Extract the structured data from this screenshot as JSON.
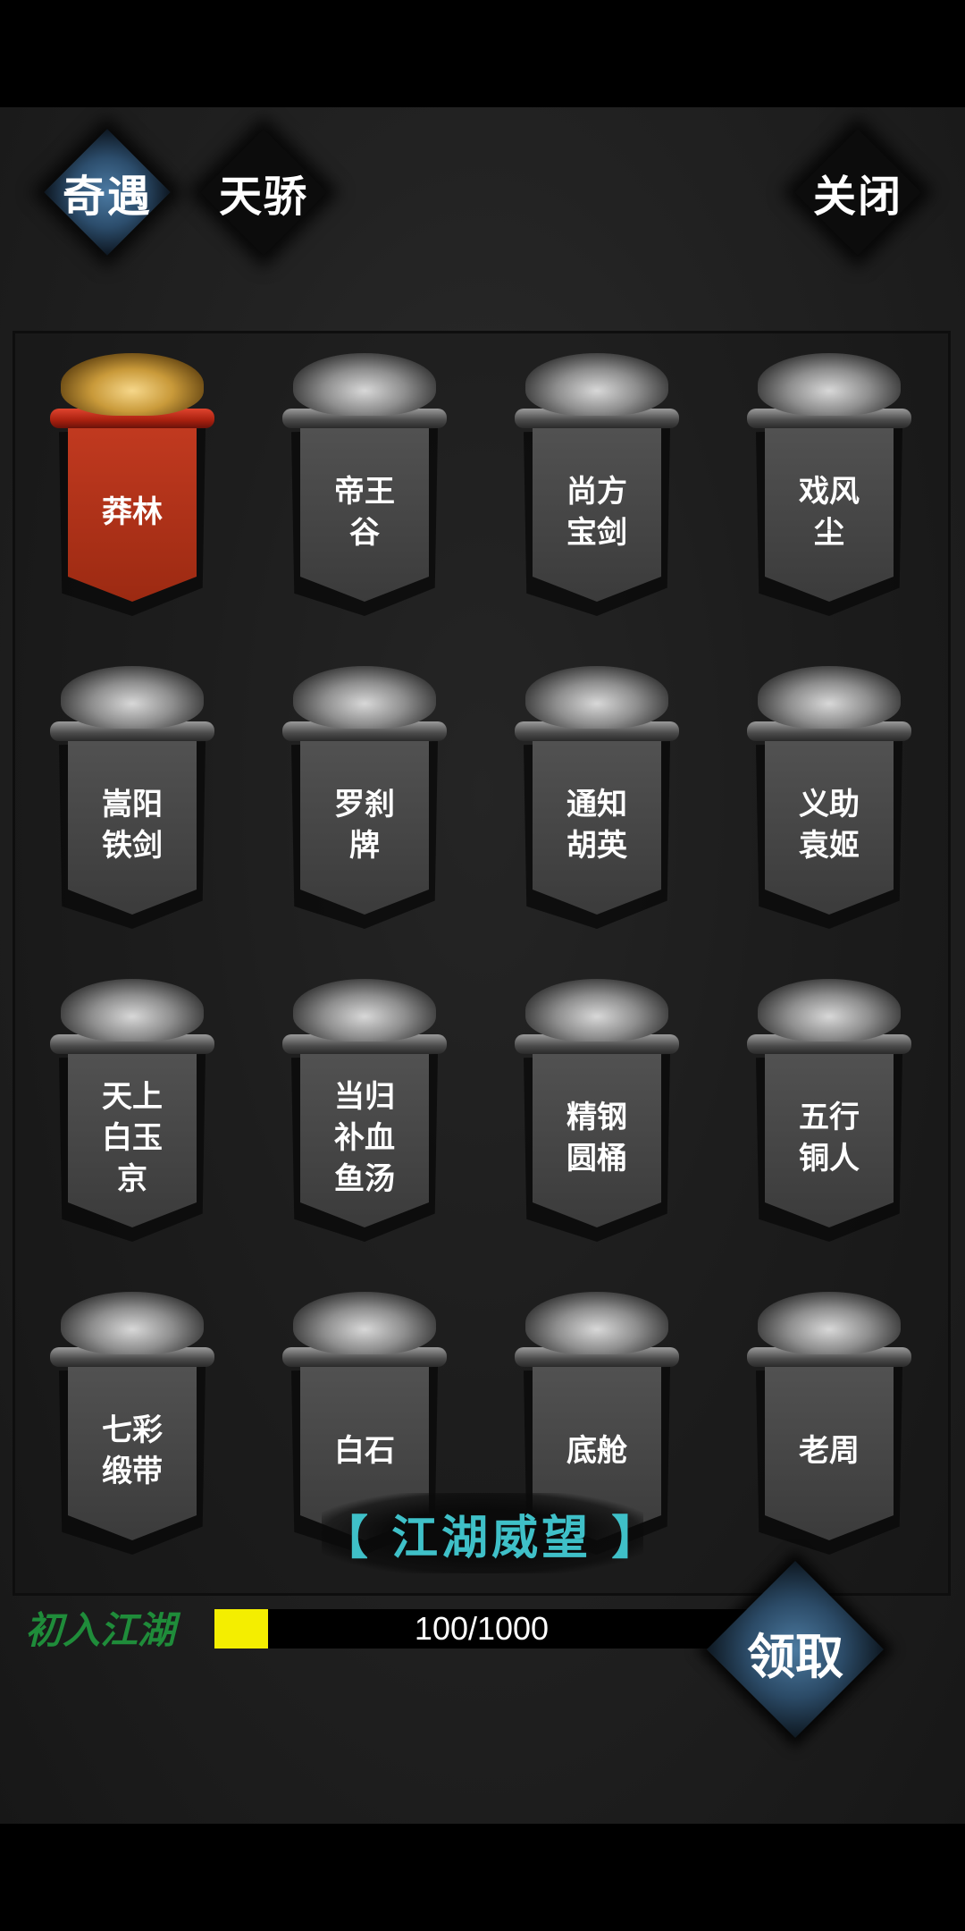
{
  "tabs": [
    {
      "label": "奇遇",
      "active": true
    },
    {
      "label": "天骄",
      "active": false
    }
  ],
  "close_label": "关闭",
  "encounters": [
    {
      "name": "莽林",
      "highlighted": true
    },
    {
      "name": "帝王谷"
    },
    {
      "name": "尚方宝剑"
    },
    {
      "name": "戏风尘"
    },
    {
      "name": "嵩阳铁剑"
    },
    {
      "name": "罗刹牌"
    },
    {
      "name": "通知胡英"
    },
    {
      "name": "义助袁姬"
    },
    {
      "name": "天上白玉京"
    },
    {
      "name": "当归补血鱼汤"
    },
    {
      "name": "精钢圆桶"
    },
    {
      "name": "五行铜人"
    },
    {
      "name": "七彩缎带"
    },
    {
      "name": "白石"
    },
    {
      "name": "底舱"
    },
    {
      "name": "老周"
    }
  ],
  "reputation": {
    "title": "【 江湖威望 】",
    "rank": "初入江湖",
    "progress_text": "100/1000",
    "progress_fraction": 0.1
  },
  "claim_label": "领取",
  "colors": {
    "highlight_banner": "#c23a20",
    "title_cyan": "#3fc0c8",
    "rank_green": "#1f8c3a",
    "progress_fill": "#f4ee00"
  }
}
